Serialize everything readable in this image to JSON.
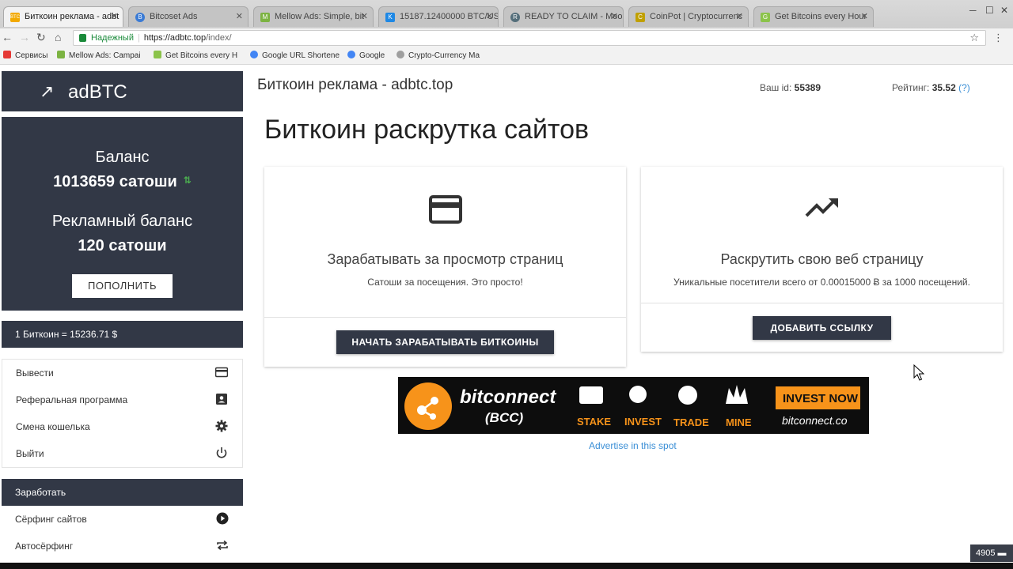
{
  "browser": {
    "tabs": [
      {
        "label": "Биткоин реклама - adbt",
        "fav": "BTC",
        "fav_color": "#f2a900",
        "active": true
      },
      {
        "label": "Bitcoset Ads",
        "fav": "B",
        "fav_color": "#3a7bd5",
        "active": false
      },
      {
        "label": "Mellow Ads: Simple, bit",
        "fav": "M",
        "fav_color": "#7cb342",
        "active": false
      },
      {
        "label": "15187.12400000 BTC/US",
        "fav": "K",
        "fav_color": "#1e88e5",
        "active": false
      },
      {
        "label": "READY TO CLAIM - Moo",
        "fav": "R",
        "fav_color": "#546e7a",
        "active": false
      },
      {
        "label": "CoinPot | Cryptocurrenc",
        "fav": "C",
        "fav_color": "#c0a000",
        "active": false
      },
      {
        "label": "Get Bitcoins every Hour",
        "fav": "G",
        "fav_color": "#8bc34a",
        "active": false
      }
    ],
    "address": {
      "secure_label": "Надежный",
      "url_host": "https://adbtc.top",
      "url_path": "/index/"
    },
    "bookmarks": [
      {
        "label": "Сервисы",
        "color": "#e53935"
      },
      {
        "label": "Mellow Ads: Campai",
        "color": "#7cb342"
      },
      {
        "label": "Get Bitcoins every H",
        "color": "#8bc34a"
      },
      {
        "label": "Google URL Shortene",
        "color": "#4285f4"
      },
      {
        "label": "Google",
        "color": "#4285f4"
      },
      {
        "label": "Crypto-Currency Ma",
        "color": "#9e9e9e"
      }
    ]
  },
  "sidebar": {
    "logo": "adBTC",
    "balance_label": "Баланс",
    "balance_value": "1013659 сатоши",
    "ad_balance_label": "Рекламный баланс",
    "ad_balance_value": "120 сатоши",
    "topup_button": "ПОПОЛНИТЬ",
    "rate": "1 Биткоин = 15236.71 $",
    "menu": [
      {
        "label": "Вывести",
        "icon": "card-icon"
      },
      {
        "label": "Реферальная программа",
        "icon": "contact-card-icon"
      },
      {
        "label": "Смена кошелька",
        "icon": "gear-icon"
      },
      {
        "label": "Выйти",
        "icon": "power-icon"
      }
    ],
    "earn_header": "Заработать",
    "earn_menu": [
      {
        "label": "Сёрфинг сайтов",
        "icon": "play-circle-icon"
      },
      {
        "label": "Автосёрфинг",
        "icon": "repeat-icon"
      }
    ]
  },
  "header": {
    "title": "Биткоин реклама - adbtc.top",
    "user_id_label": "Ваш id:",
    "user_id": "55389",
    "rating_label": "Рейтинг:",
    "rating": "35.52",
    "rating_help": "(?)"
  },
  "main": {
    "heading": "Биткоин раскрутка сайтов",
    "earn_card": {
      "icon": "credit-card-icon",
      "title": "Зарабатывать за просмотр страниц",
      "subtitle": "Сатоши за посещения. Это просто!",
      "button": "НАЧАТЬ ЗАРАБАТЫВАТЬ БИТКОИНЫ"
    },
    "promote_card": {
      "icon": "trending-up-icon",
      "title": "Раскрутить свою веб страницу",
      "subtitle": "Уникальные посетители всего от 0.00015000 Ƀ за 1000 посещений.",
      "button": "ДОБАВИТЬ ССЫЛКУ"
    },
    "banner": {
      "brand": "bitconnect",
      "ticker": "(BCC)",
      "items": [
        "STAKE",
        "INVEST",
        "TRADE",
        "MINE"
      ],
      "cta": "INVEST NOW",
      "site": "bitconnect.co"
    },
    "advertise_link": "Advertise in this spot"
  },
  "counter": "4905",
  "colors": {
    "panel": "#323846",
    "accent_link": "#3b8fd6",
    "secure_green": "#1a8a3a",
    "banner_orange": "#f7931a"
  }
}
